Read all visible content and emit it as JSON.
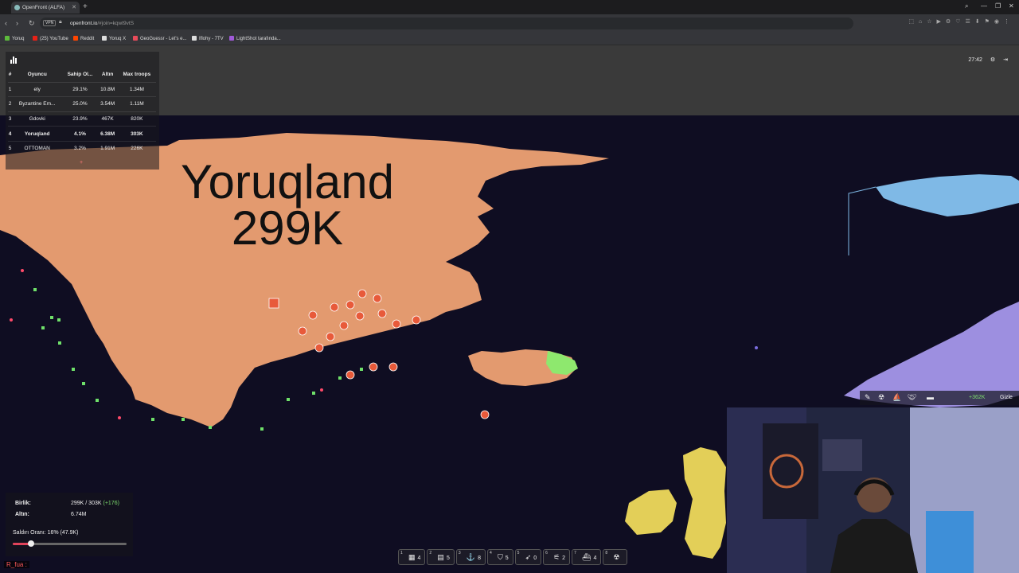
{
  "browser": {
    "tab_title": "OpenFront (ALFA)",
    "url_host": "openfront.io",
    "url_path": "/#join=kqwt9vtS",
    "vpn_label": "VPN",
    "bookmarks": [
      {
        "label": "Yoruq",
        "color": "#5dbb3c"
      },
      {
        "label": "(25) YouTube",
        "color": "#e62117"
      },
      {
        "label": "Reddit",
        "color": "#ff4500"
      },
      {
        "label": "Yoruq X",
        "color": "#dddddd"
      },
      {
        "label": "GeoGuessr - Let's e...",
        "color": "#e84b5a"
      },
      {
        "label": "Iflohy - 7TV",
        "color": "#dddddd"
      },
      {
        "label": "LightShot tarafında...",
        "color": "#a05ad8"
      }
    ]
  },
  "leaderboard": {
    "headers": [
      "#",
      "Oyuncu",
      "Sahip Ol...",
      "Altın",
      "Max troops"
    ],
    "rows": [
      {
        "rank": "1",
        "name": "ely",
        "owned": "29.1%",
        "gold": "10.8M",
        "troops": "1.34M"
      },
      {
        "rank": "2",
        "name": "Byzantine Em...",
        "owned": "25.0%",
        "gold": "3.54M",
        "troops": "1.11M"
      },
      {
        "rank": "3",
        "name": "Gdovki",
        "owned": "23.9%",
        "gold": "467K",
        "troops": "820K"
      },
      {
        "rank": "4",
        "name": "Yoruqland",
        "owned": "4.1%",
        "gold": "6.38M",
        "troops": "303K"
      },
      {
        "rank": "5",
        "name": "OTTOMAN",
        "owned": "3.2%",
        "gold": "1.91M",
        "troops": "226K"
      }
    ],
    "highlight_rank": "4",
    "expand_glyph": "+"
  },
  "timer": "27:42",
  "map_label": {
    "name": "Yoruqland",
    "troops": "299K"
  },
  "stats": {
    "troops_label": "Birlik:",
    "troops_value": "299K / 303K",
    "troops_delta": "(+176)",
    "gold_label": "Altın:",
    "gold_value": "6.74M",
    "attack_label": "Saldırı Oranı: 16% (47.9K)",
    "attack_ratio": 0.16
  },
  "chat": "R_fua :",
  "buildbar": [
    {
      "key": "1",
      "icon": "city-icon",
      "glyph": "▦",
      "count": "4"
    },
    {
      "key": "2",
      "icon": "factory-icon",
      "glyph": "▤",
      "count": "5"
    },
    {
      "key": "3",
      "icon": "port-icon",
      "glyph": "⚓",
      "count": "8"
    },
    {
      "key": "4",
      "icon": "defense-post-icon",
      "glyph": "⛉",
      "count": "5"
    },
    {
      "key": "5",
      "icon": "missile-silo-icon",
      "glyph": "➶",
      "count": "0"
    },
    {
      "key": "6",
      "icon": "sam-launcher-icon",
      "glyph": "⚟",
      "count": "2"
    },
    {
      "key": "7",
      "icon": "warship-icon",
      "glyph": "⛴",
      "count": "4"
    },
    {
      "key": "8",
      "icon": "nuke-icon",
      "glyph": "☢",
      "count": ""
    }
  ],
  "right_bar": {
    "gold_rate": "+362K",
    "hide_label": "Gizle"
  },
  "colors": {
    "ocean": "#0f0d22",
    "player": "#e39a6f",
    "ally_green": "#8ee86e",
    "enemy_blue": "#7fb9e6",
    "enemy_purple": "#9d8fe0",
    "britain_yellow": "#e3cf58"
  }
}
